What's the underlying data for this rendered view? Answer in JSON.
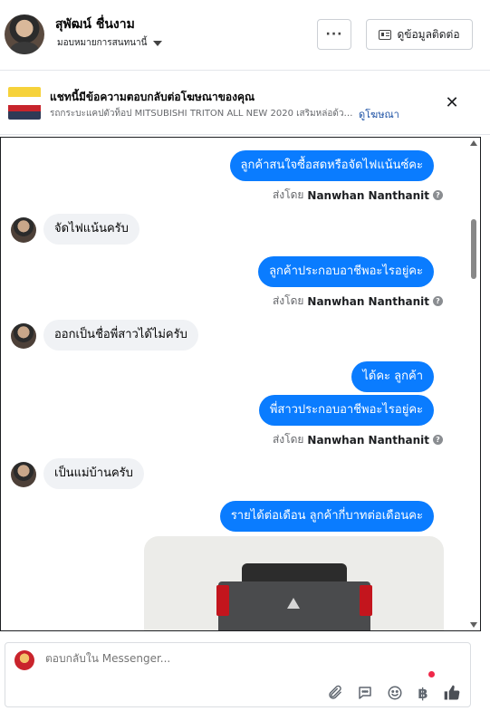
{
  "header": {
    "contact_name": "สุพัฒน์ ชื่นงาม",
    "assignee_label": "มอบหมายการสนทนานี้",
    "more_label": "···",
    "view_contact_label": "ดูข้อมูลติดต่อ"
  },
  "ad": {
    "title": "แชทนี้มีข้อความตอบกลับต่อโฆษณาของคุณ",
    "subtitle": "รถกระบะแคปตัวท็อป MITSUBISHI TRITON ALL NEW 2020 เสริมหล่อด้วย...",
    "link_label": "ดูโฆษณา",
    "close_glyph": "✕"
  },
  "thread": {
    "messages": [
      {
        "direction": "out",
        "text": "ลูกค้าสนใจซื้อสดหรือจัดไฟแน้นซ์คะ"
      },
      {
        "direction": "sent_by",
        "prefix": "ส่งโดย",
        "name": "Nanwhan Nanthanit"
      },
      {
        "direction": "in",
        "text": "จัดไฟแน้นครับ"
      },
      {
        "direction": "out",
        "text": "ลูกค้าประกอบอาชีพอะไรอยู่คะ"
      },
      {
        "direction": "sent_by",
        "prefix": "ส่งโดย",
        "name": "Nanwhan Nanthanit"
      },
      {
        "direction": "in",
        "text": "ออกเป็นชื่อพี่สาวได้ไม่ครับ"
      },
      {
        "direction": "out",
        "text": "ได้คะ ลูกค้า"
      },
      {
        "direction": "out",
        "text": "พี่สาวประกอบอาชีพอะไรอยู่คะ"
      },
      {
        "direction": "sent_by",
        "prefix": "ส่งโดย",
        "name": "Nanwhan Nanthanit"
      },
      {
        "direction": "in",
        "text": "เป็นแม่บ้านครับ"
      },
      {
        "direction": "out",
        "text": "รายได้ต่อเดือน ลูกค้ากี่บาทต่อเดือนคะ"
      }
    ],
    "help_glyph": "?"
  },
  "composer": {
    "placeholder": "ตอบกลับใน Messenger...",
    "tools": [
      "paperclip-icon",
      "chat-bubble-icon",
      "smiley-icon",
      "baht-icon",
      "thumbs-up-icon"
    ],
    "baht_glyph": "฿"
  },
  "colors": {
    "outgoing_bubble": "#0a7cff",
    "incoming_bubble": "#f0f2f5",
    "link": "#1a4fa3",
    "notification_dot": "#f02849"
  }
}
